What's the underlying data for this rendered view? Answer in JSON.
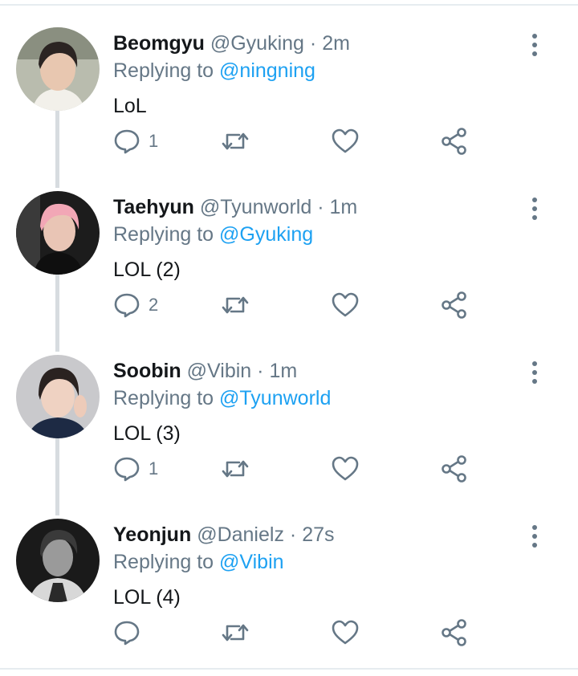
{
  "tweets": [
    {
      "name": "Beomgyu",
      "handle": "@Gyuking",
      "separator": "·",
      "time": "2m",
      "replying_prefix": "Replying to",
      "replying_to": "@ningning",
      "text": "LoL",
      "reply_count": "1"
    },
    {
      "name": "Taehyun",
      "handle": "@Tyunworld",
      "separator": "·",
      "time": "1m",
      "replying_prefix": "Replying to",
      "replying_to": "@Gyuking",
      "text": "LOL (2)",
      "reply_count": "2"
    },
    {
      "name": "Soobin",
      "handle": "@Vibin",
      "separator": "·",
      "time": "1m",
      "replying_prefix": "Replying to",
      "replying_to": "@Tyunworld",
      "text": "LOL (3)",
      "reply_count": "1"
    },
    {
      "name": "Yeonjun",
      "handle": "@Danielz",
      "separator": "·",
      "time": "27s",
      "replying_prefix": "Replying to",
      "replying_to": "@Vibin",
      "text": "LOL (4)",
      "reply_count": ""
    }
  ],
  "icons": {
    "reply": "speech-bubble-icon",
    "retweet": "retweet-arrows-icon",
    "like": "heart-icon",
    "share": "share-nodes-icon",
    "more": "vertical-dots-icon"
  },
  "colors": {
    "text_primary": "#14171a",
    "text_secondary": "#657786",
    "mention": "#1da1f2",
    "thread_line": "#d7dce0",
    "divider": "#e6ecf0"
  }
}
